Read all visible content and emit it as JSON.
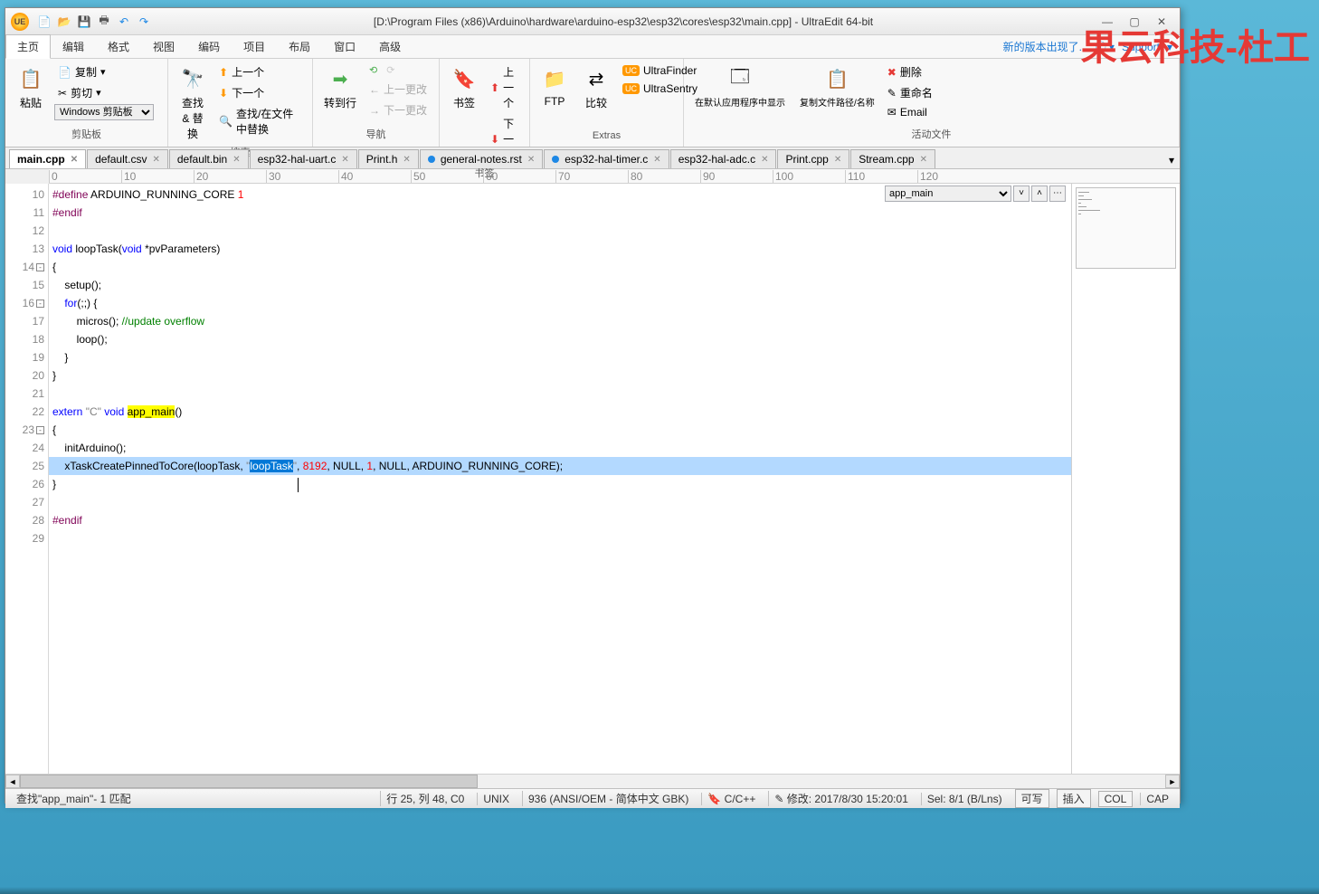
{
  "app_icon_text": "UE",
  "title": "[D:\\Program Files (x86)\\Arduino\\hardware\\arduino-esp32\\esp32\\cores\\esp32\\main.cpp] - UltraEdit 64-bit",
  "watermark": "果云科技-杜工",
  "menu_right": {
    "notice": "新的版本出现了...",
    "support": "Support"
  },
  "menu": [
    "主页",
    "编辑",
    "格式",
    "视图",
    "编码",
    "项目",
    "布局",
    "窗口",
    "高级"
  ],
  "ribbon": {
    "group1": {
      "paste": "粘贴",
      "copy": "复制",
      "cut": "剪切",
      "clipboard_sel": "Windows 剪贴板",
      "label": "剪贴板"
    },
    "group2": {
      "find": "查找\n& 替换",
      "prev": "上一个",
      "next": "下一个",
      "find_in_files": "查找/在文件中替换",
      "label": "搜索"
    },
    "group3": {
      "goto": "转到行",
      "back": "",
      "fwd": "",
      "prev_change": "上一更改",
      "next_change": "下一更改",
      "label": "导航"
    },
    "group4": {
      "bookmark": "书签",
      "prev": "上一个",
      "next": "下一个",
      "label": "书签"
    },
    "group5": {
      "ftp": "FTP",
      "compare": "比较",
      "ultrafinder": "UltraFinder",
      "ultrasentry": "UltraSentry",
      "label": "Extras"
    },
    "group6": {
      "open_default": "在默认应用程序中显示",
      "copy_path": "复制文件路径/名称",
      "delete": "删除",
      "rename": "重命名",
      "email": "Email",
      "label": "活动文件"
    }
  },
  "tabs": [
    {
      "name": "main.cpp",
      "active": true,
      "dot": ""
    },
    {
      "name": "default.csv",
      "dot": ""
    },
    {
      "name": "default.bin",
      "dot": ""
    },
    {
      "name": "esp32-hal-uart.c",
      "dot": ""
    },
    {
      "name": "Print.h",
      "dot": ""
    },
    {
      "name": "general-notes.rst",
      "dot": "blue"
    },
    {
      "name": "esp32-hal-timer.c",
      "dot": "blue"
    },
    {
      "name": "esp32-hal-adc.c",
      "dot": ""
    },
    {
      "name": "Print.cpp",
      "dot": ""
    },
    {
      "name": "Stream.cpp",
      "dot": ""
    }
  ],
  "func_dropdown": "app_main",
  "code_lines": {
    "l10a": "#define",
    "l10b": " ARDUINO_RUNNING_CORE ",
    "l10c": "1",
    "l11": "#endif",
    "l13a": "void",
    "l13b": " loopTask(",
    "l13c": "void",
    "l13d": " *pvParameters)",
    "l14": "{",
    "l15": "    setup();",
    "l16a": "    ",
    "l16b": "for",
    "l16c": "(;;) {",
    "l17a": "        micros(); ",
    "l17b": "//update overflow",
    "l18": "        loop();",
    "l19": "    }",
    "l20": "}",
    "l22a": "extern",
    "l22b": " ",
    "l22c": "\"C\"",
    "l22d": " ",
    "l22e": "void",
    "l22f": " ",
    "l22g": "app_main",
    "l22h": "()",
    "l23": "{",
    "l24": "    initArduino();",
    "l25a": "    xTaskCreatePinnedToCore(loopTask, ",
    "l25b": "\"",
    "l25c": "loopTask",
    "l25d": "\"",
    "l25e": ", ",
    "l25f": "8192",
    "l25g": ", NULL, ",
    "l25h": "1",
    "l25i": ", NULL, ARDUINO_RUNNING_CORE);",
    "l26": "}",
    "l28": "#endif"
  },
  "gutter": [
    "10",
    "11",
    "12",
    "13",
    "14",
    "15",
    "16",
    "17",
    "18",
    "19",
    "20",
    "21",
    "22",
    "23",
    "24",
    "25",
    "26",
    "27",
    "28",
    "29"
  ],
  "status": {
    "find": "查找\"app_main\"- 1 匹配",
    "pos": "行 25, 列 48, C0",
    "eol": "UNIX",
    "cp": "936  (ANSI/OEM - 简体中文 GBK)",
    "lang": "C/C++",
    "mod": "修改:  2017/8/30 15:20:01",
    "sel": "Sel: 8/1 (B/Lns)",
    "rw": "可写",
    "ins": "插入",
    "col": "COL",
    "cap": "CAP"
  },
  "ruler_marks": [
    "0",
    "10",
    "20",
    "30",
    "40",
    "50",
    "60",
    "70",
    "80",
    "90",
    "100",
    "110",
    "120"
  ]
}
